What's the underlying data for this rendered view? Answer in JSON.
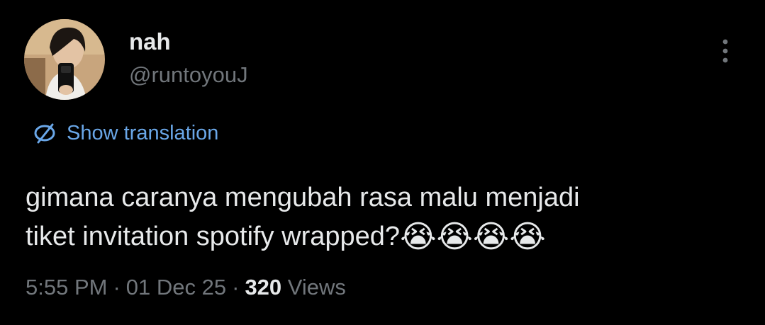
{
  "author": {
    "display_name": "nah",
    "handle": "@runtoyouJ"
  },
  "translate": {
    "label": "Show translation",
    "icon": "globe-icon"
  },
  "tweet": {
    "text": "gimana caranya mengubah rasa malu menjadi\ntiket invitation spotify wrapped?",
    "emoji": "😭😭😭😭"
  },
  "meta": {
    "time": "5:55 PM",
    "separator": "·",
    "date": "01 Dec 25",
    "views_count": "320",
    "views_label": "Views"
  },
  "colors": {
    "background": "#000000",
    "primary_text": "#e7e9ea",
    "secondary_text": "#71767b",
    "link": "#6aa7e8"
  },
  "icons": {
    "more": "more-vertical-icon",
    "translate": "globe-icon"
  }
}
